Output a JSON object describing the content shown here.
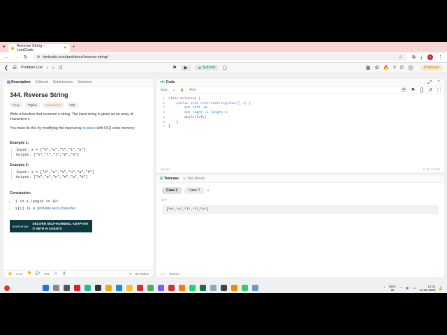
{
  "browser": {
    "tab_title": "Reverse String - LeetCode",
    "url": "leetcode.com/problems/reverse-string/"
  },
  "topbar": {
    "problem_list": "Problem List",
    "submit": "Submit",
    "count": "0",
    "premium": "Premium"
  },
  "desc_tabs": [
    "Description",
    "Editorial",
    "Submissions",
    "Solutions"
  ],
  "problem": {
    "title": "344. Reverse String",
    "tags": [
      "Easy",
      "Topics",
      "Companies",
      "Hint"
    ],
    "para1": "Write a function that reverses a string. The input string is given as an array of characters s.",
    "para2_a": "You must do this by modifying the input array ",
    "para2_link": "in-place",
    "para2_b": " with O(1) extra memory.",
    "ex1_label": "Example 1:",
    "ex1_input": "Input: s = [\"h\",\"e\",\"l\",\"l\",\"o\"]",
    "ex1_output": "Output: [\"o\",\"l\",\"l\",\"e\",\"h\"]",
    "ex2_label": "Example 2:",
    "ex2_input": "Input: s = [\"H\",\"a\",\"n\",\"n\",\"a\",\"h\"]",
    "ex2_output": "Output: [\"h\",\"a\",\"n\",\"n\",\"a\",\"H\"]",
    "constraints_label": "Constraints:",
    "c1": "1 <= s.length <= 10⁵",
    "c2_a": "s[i] is a ",
    "c2_link": "printable ascii character",
    "c2_b": "."
  },
  "ad": {
    "brand": "servicenow",
    "text": "DELIVER SELF-RUNNING, ADAPTIVE IT WITH AI AGENTS"
  },
  "desc_footer": {
    "likes": "5.1K",
    "comments": "272",
    "online": "90 Online"
  },
  "code_panel": {
    "title": "Code",
    "lang": "Java",
    "mode": "Auto",
    "lines": [
      "class Solution {",
      "    public void reverseString(char[] s) {",
      "        int left =0;",
      "        int right =s.length-1;",
      "        while(left)",
      "    }",
      "}"
    ],
    "status": "Saved",
    "cursor": "Ln 5, Col 18"
  },
  "testcase": {
    "tab1": "Testcase",
    "tab2": "Test Result",
    "cases": [
      "Case 1",
      "Case 2"
    ],
    "var_label": "s =",
    "value": "[\"h\",\"e\",\"l\",\"l\",\"o\"]",
    "source": "Source"
  },
  "taskbar": {
    "lang": "ENG",
    "region": "IN",
    "time": "12:41",
    "date": "11-08-2025"
  }
}
